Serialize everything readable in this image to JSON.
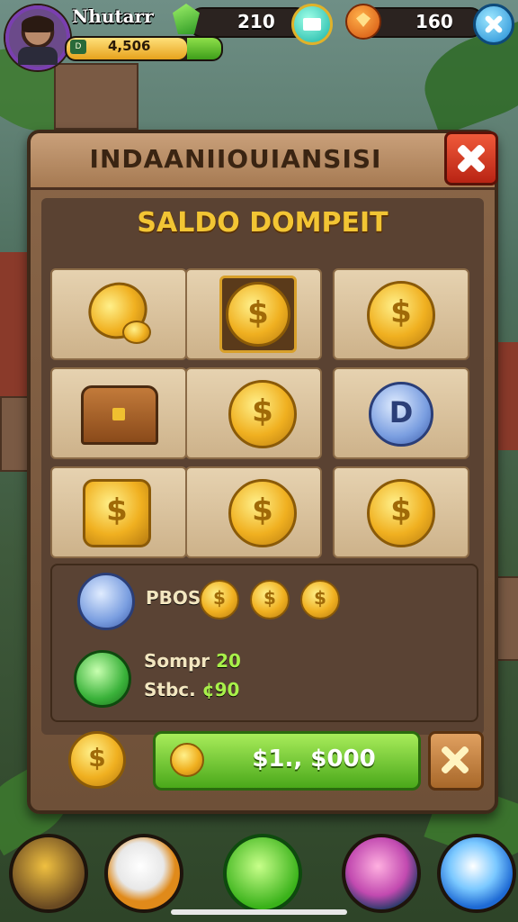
{
  "player": {
    "name": "Nhutarr",
    "xp_value": "4,506",
    "xp_progress": 0.83,
    "level_badge": "D"
  },
  "resources": {
    "gems": "210",
    "gold": "160"
  },
  "dialog": {
    "title": "INDAANIIOUIANSISI",
    "subtitle": "SALDO DOMPEIT"
  },
  "grid": [
    [
      {
        "type": "coin-pile"
      },
      {
        "type": "framed-coin",
        "symbol": "$"
      },
      {
        "type": "coin",
        "symbol": "$"
      }
    ],
    [
      {
        "type": "chest"
      },
      {
        "type": "coin",
        "symbol": "$"
      },
      {
        "type": "blue-coin",
        "symbol": "D"
      }
    ],
    [
      {
        "type": "square-coin",
        "symbol": "$"
      },
      {
        "type": "coin",
        "symbol": "$"
      },
      {
        "type": "coin",
        "symbol": "$"
      }
    ]
  ],
  "info": {
    "pbos_label": "PBOS",
    "pbos_coins": [
      "$",
      "$",
      "$"
    ],
    "sompr_label": "Sompr",
    "sompr_value": "20",
    "stbc_label": "Stbc.",
    "stbc_value": "¢90"
  },
  "footer": {
    "coin_symbol": "$",
    "buy_label": "$1., $000",
    "buy_coin_symbol": "$"
  },
  "nav": [
    "crown-icon",
    "feather-icon",
    "sword-icon",
    "gem-box-icon",
    "star-icon"
  ],
  "colors": {
    "panel": "#8a6648",
    "accent_gold": "#f2c534",
    "buy_green": "#4aa81a",
    "close_red": "#b82414"
  }
}
